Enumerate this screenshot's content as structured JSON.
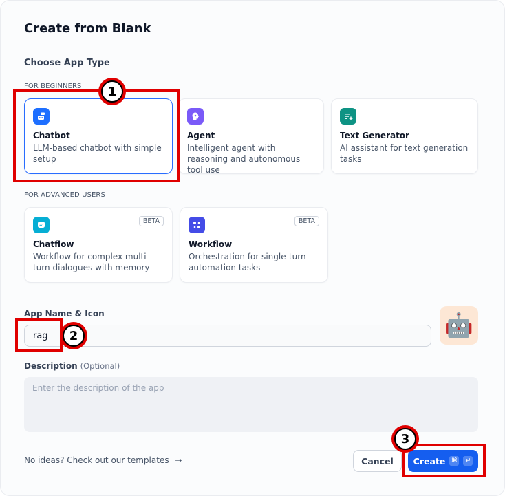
{
  "dialog": {
    "title": "Create from Blank"
  },
  "app_type": {
    "label": "Choose App Type",
    "beginners_label": "FOR BEGINNERS",
    "advanced_label": "FOR ADVANCED USERS",
    "beginners": [
      {
        "name": "Chatbot",
        "desc": "LLM-based chatbot with simple setup",
        "icon": "chatbot-icon",
        "color": "#1e6fff",
        "selected": true
      },
      {
        "name": "Agent",
        "desc": "Intelligent agent with reasoning and autonomous tool use",
        "icon": "agent-icon",
        "color": "#7a5af8",
        "selected": false
      },
      {
        "name": "Text Generator",
        "desc": "AI assistant for text generation tasks",
        "icon": "text-generator-icon",
        "color": "#0e9384",
        "selected": false
      }
    ],
    "advanced": [
      {
        "name": "Chatflow",
        "desc": "Workflow for complex multi-turn dialogues with memory",
        "icon": "chatflow-icon",
        "color": "#06aed4",
        "badge": "BETA"
      },
      {
        "name": "Workflow",
        "desc": "Orchestration for single-turn automation tasks",
        "icon": "workflow-icon",
        "color": "#444ce7",
        "badge": "BETA"
      }
    ]
  },
  "app_name": {
    "label": "App Name & Icon",
    "value": "rag",
    "icon": "🤖",
    "icon_bg": "#fde7d5"
  },
  "description": {
    "label": "Description",
    "optional": "(Optional)",
    "placeholder": "Enter the description of the app"
  },
  "footer": {
    "templates_link": "No ideas? Check out our templates",
    "cancel_label": "Cancel",
    "create_label": "Create",
    "shortcut_cmd": "⌘",
    "shortcut_enter": "↵"
  },
  "annotations": {
    "step1": "1",
    "step2": "2",
    "step3": "3"
  },
  "colors": {
    "accent": "#155eef",
    "highlight": "#e00000"
  }
}
